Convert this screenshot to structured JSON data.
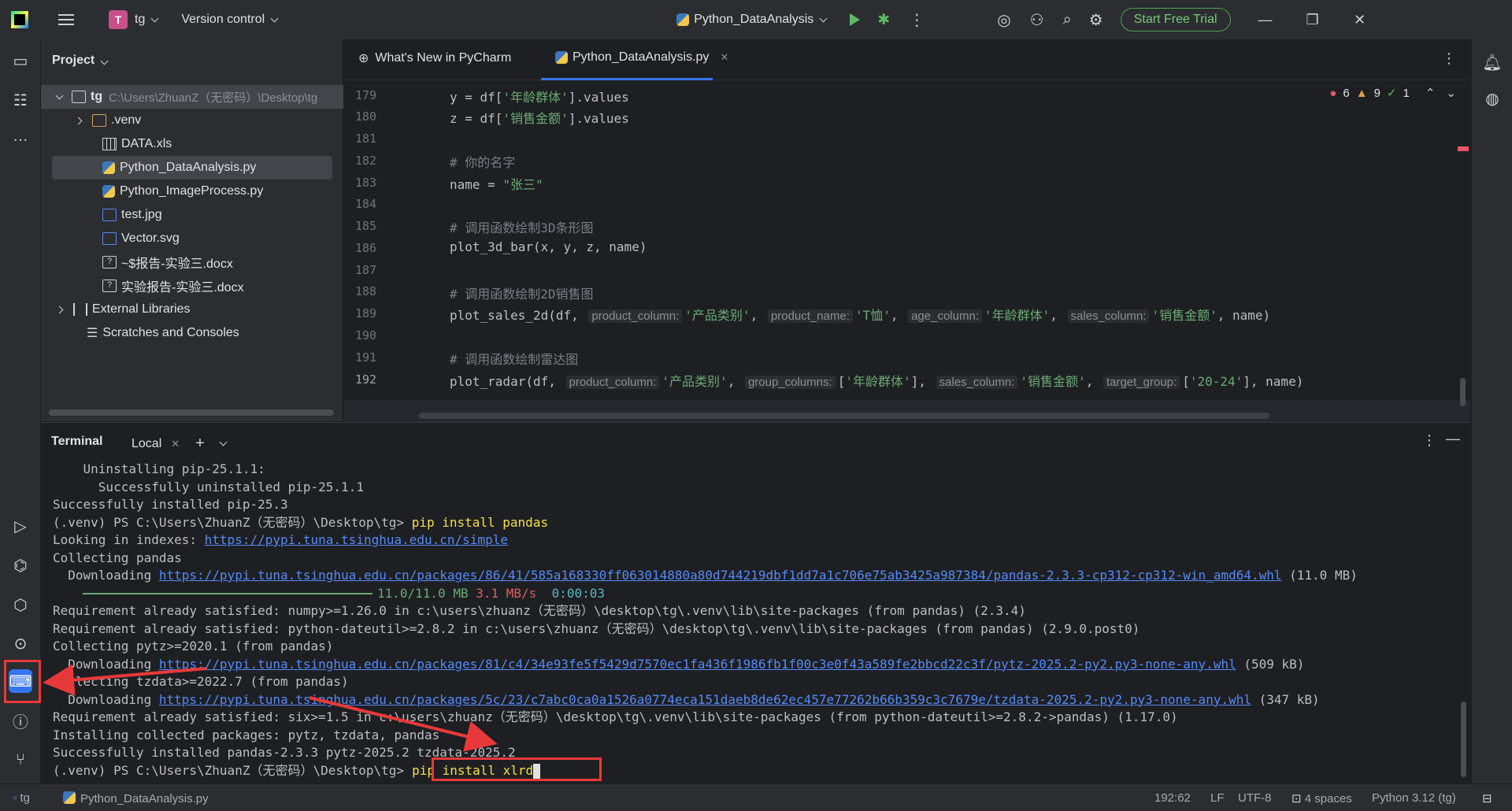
{
  "titlebar": {
    "project_badge": "T",
    "project_name": "tg",
    "vcs": "Version control",
    "run_config": "Python_DataAnalysis",
    "trial_button": "Start Free Trial"
  },
  "project_panel": {
    "title": "Project",
    "root": {
      "name": "tg",
      "path": "C:\\Users\\ZhuanZ（无密码）\\Desktop\\tg"
    },
    "items": [
      {
        "label": ".venv",
        "kind": "folder"
      },
      {
        "label": "DATA.xls",
        "kind": "table"
      },
      {
        "label": "Python_DataAnalysis.py",
        "kind": "python"
      },
      {
        "label": "Python_ImageProcess.py",
        "kind": "python"
      },
      {
        "label": "test.jpg",
        "kind": "image"
      },
      {
        "label": "Vector.svg",
        "kind": "image"
      },
      {
        "label": "~$报告-实验三.docx",
        "kind": "unknown"
      },
      {
        "label": "实验报告-实验三.docx",
        "kind": "unknown"
      },
      {
        "label": "External Libraries",
        "kind": "library"
      },
      {
        "label": "Scratches and Consoles",
        "kind": "scratches"
      }
    ]
  },
  "editor": {
    "tabs": [
      {
        "label": "What's New in PyCharm",
        "active": false
      },
      {
        "label": "Python_DataAnalysis.py",
        "active": true
      }
    ],
    "inspections": {
      "errors": "6",
      "warnings": "9",
      "ok": "1"
    },
    "line_numbers": [
      "179",
      "180",
      "181",
      "182",
      "183",
      "184",
      "185",
      "186",
      "187",
      "188",
      "189",
      "190",
      "191",
      "192"
    ],
    "code": {
      "l179_pre": "y = df[",
      "l179_str": "'年龄群体'",
      "l179_post": "].values",
      "l180_pre": "z = df[",
      "l180_str": "'销售金额'",
      "l180_post": "].values",
      "l182_comment": "# 你的名字",
      "l183_pre": "name = ",
      "l183_str": "\"张三\"",
      "l185_comment": "# 调用函数绘制3D条形图",
      "l186": "plot_3d_bar(x, y, z, name)",
      "l188_comment": "# 调用函数绘制2D销售图",
      "l189_fn": "plot_sales_2d(df, ",
      "l189_h1": "product_column:",
      "l189_s1": "'产品类别'",
      "l189_h2": "product_name:",
      "l189_s2": "'T恤'",
      "l189_h3": "age_column:",
      "l189_s3": "'年龄群体'",
      "l189_h4": "sales_column:",
      "l189_s4": "'销售金额'",
      "l189_end": ", name)",
      "l191_comment": "# 调用函数绘制雷达图",
      "l192_fn": "plot_radar(df, ",
      "l192_h1": "product_column:",
      "l192_s1": "'产品类别'",
      "l192_h2": "group_columns:",
      "l192_s2": "'年龄群体'",
      "l192_h3": "sales_column:",
      "l192_s3": "'销售金额'",
      "l192_h4": "target_group:",
      "l192_s4": "'20-24'",
      "l192_end": "], name)"
    }
  },
  "terminal": {
    "title": "Terminal",
    "tab": "Local",
    "lines": {
      "t1": "    Uninstalling pip-25.1.1:",
      "t2": "      Successfully uninstalled pip-25.1.1",
      "t3": "Successfully installed pip-25.3",
      "t4_prompt": "(.venv) PS C:\\Users\\ZhuanZ（无密码）\\Desktop\\tg> ",
      "t4_cmd": "pip install pandas",
      "t5_pre": "Looking in indexes: ",
      "t5_link": "https://pypi.tuna.tsinghua.edu.cn/simple",
      "t6": "Collecting pandas",
      "t7_pre": "  Downloading ",
      "t7_link": "https://pypi.tuna.tsinghua.edu.cn/packages/86/41/585a168330ff063014880a80d744219dbf1dd7a1c706e75ab3425a987384/pandas-2.3.3-cp312-cp312-win_amd64.whl",
      "t7_post": " (11.0 MB)",
      "t8_size": "11.0/11.0 MB",
      "t8_rate": "3.1 MB/s",
      "t8_eta": "0:00:03",
      "t9": "Requirement already satisfied: numpy>=1.26.0 in c:\\users\\zhuanz（无密码）\\desktop\\tg\\.venv\\lib\\site-packages (from pandas) (2.3.4)",
      "t10": "Requirement already satisfied: python-dateutil>=2.8.2 in c:\\users\\zhuanz（无密码）\\desktop\\tg\\.venv\\lib\\site-packages (from pandas) (2.9.0.post0)",
      "t11": "Collecting pytz>=2020.1 (from pandas)",
      "t12_pre": "  Downloading ",
      "t12_link": "https://pypi.tuna.tsinghua.edu.cn/packages/81/c4/34e93fe5f5429d7570ec1fa436f1986fb1f00c3e0f43a589fe2bbcd22c3f/pytz-2025.2-py2.py3-none-any.whl",
      "t12_post": " (509 kB)",
      "t13": "Collecting tzdata>=2022.7 (from pandas)",
      "t14_pre": "  Downloading ",
      "t14_link": "https://pypi.tuna.tsinghua.edu.cn/packages/5c/23/c7abc0ca0a1526a0774eca151daeb8de62ec457e77262b66b359c3c7679e/tzdata-2025.2-py2.py3-none-any.whl",
      "t14_post": " (347 kB)",
      "t15": "Requirement already satisfied: six>=1.5 in c:\\users\\zhuanz（无密码）\\desktop\\tg\\.venv\\lib\\site-packages (from python-dateutil>=2.8.2->pandas) (1.17.0)",
      "t16": "Installing collected packages: pytz, tzdata, pandas",
      "t17": "Successfully installed pandas-2.3.3 pytz-2025.2 tzdata-2025.2",
      "t18_prompt": "(.venv) PS C:\\Users\\ZhuanZ（无密码）\\Desktop\\tg>",
      "t18_cmd": "pip install xlrd"
    }
  },
  "statusbar": {
    "project": "tg",
    "file": "Python_DataAnalysis.py",
    "position": "192:62",
    "line_sep": "LF",
    "encoding": "UTF-8",
    "indent": "4 spaces",
    "interpreter": "Python 3.12 (tg)"
  },
  "colors": {
    "annotation": "#e8393a",
    "accent": "#3574f0"
  }
}
